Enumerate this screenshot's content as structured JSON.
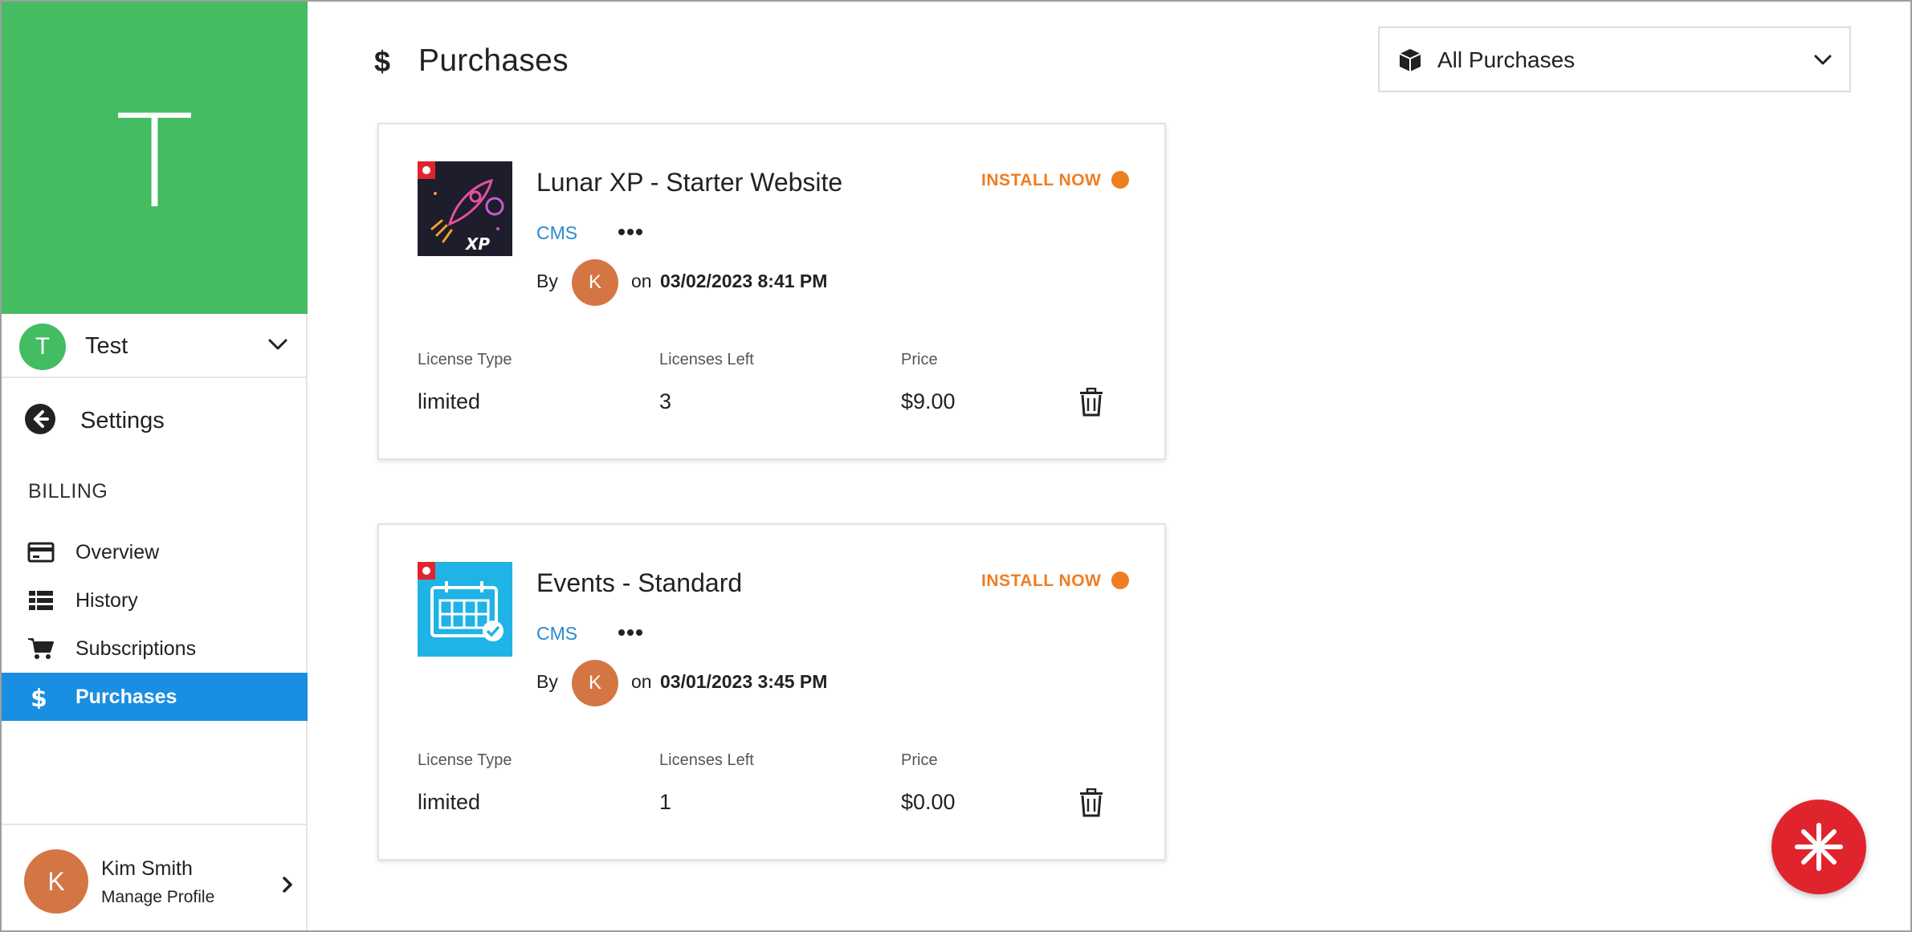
{
  "colors": {
    "brand_green": "#43bc62",
    "active_blue": "#1a8ee1",
    "install_orange": "#ef7d22",
    "avatar_orange": "#d47643",
    "link_blue": "#2a8ad0",
    "fab_red": "#e0242e"
  },
  "sidebar": {
    "brand_letter": "T",
    "workspace": {
      "avatar_letter": "T",
      "name": "Test",
      "icon": "chevron-down-icon"
    },
    "settings": {
      "label": "Settings",
      "icon": "back-arrow-circle-icon"
    },
    "section_heading": "BILLING",
    "items": [
      {
        "label": "Overview",
        "icon": "credit-card-icon",
        "active": false
      },
      {
        "label": "History",
        "icon": "list-icon",
        "active": false
      },
      {
        "label": "Subscriptions",
        "icon": "cart-icon",
        "active": false
      },
      {
        "label": "Purchases",
        "icon": "dollar-icon",
        "active": true
      }
    ],
    "profile": {
      "avatar_letter": "K",
      "name": "Kim Smith",
      "subtitle": "Manage Profile",
      "icon": "chevron-right-icon"
    }
  },
  "header": {
    "icon": "dollar-icon",
    "title": "Purchases",
    "filter": {
      "icon": "box-icon",
      "selected": "All Purchases"
    }
  },
  "purchases": [
    {
      "title": "Lunar XP - Starter Website",
      "thumbnail": "rocket-thumbnail",
      "thumbnail_text": "XP",
      "action": "INSTALL NOW",
      "category": "CMS",
      "by_label": "By",
      "author_initial": "K",
      "on_label": "on",
      "date": "03/02/2023 8:41 PM",
      "license_type_label": "License Type",
      "license_type": "limited",
      "licenses_left_label": "Licenses Left",
      "licenses_left": "3",
      "price_label": "Price",
      "price": "$9.00"
    },
    {
      "title": "Events - Standard",
      "thumbnail": "calendar-thumbnail",
      "action": "INSTALL NOW",
      "category": "CMS",
      "by_label": "By",
      "author_initial": "K",
      "on_label": "on",
      "date": "03/01/2023 3:45 PM",
      "license_type_label": "License Type",
      "license_type": "limited",
      "licenses_left_label": "Licenses Left",
      "licenses_left": "1",
      "price_label": "Price",
      "price": "$0.00"
    }
  ],
  "fab": {
    "icon": "joomla-logo-icon"
  }
}
